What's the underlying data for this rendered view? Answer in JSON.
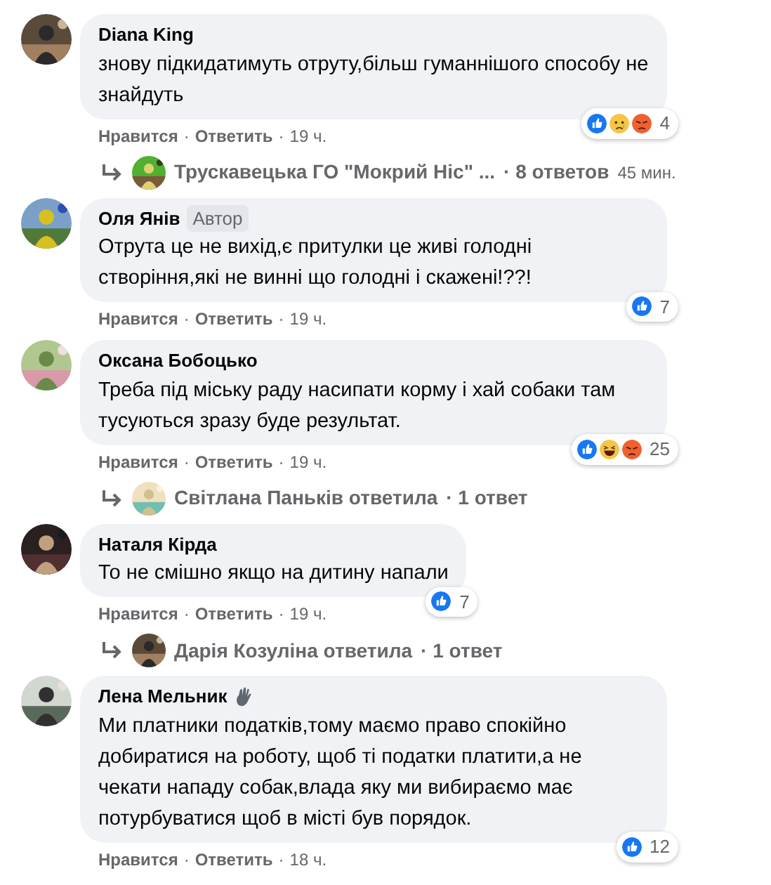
{
  "comments": [
    {
      "author": "Diana King",
      "wave": false,
      "text": "знову підкидатимуть отруту,більш гуманнішого способу не знайдуть",
      "reactions": [
        {
          "kind": "like"
        },
        {
          "kind": "sad"
        },
        {
          "kind": "angry"
        }
      ],
      "reaction_count": "4",
      "actions": {
        "like": "Нравится",
        "reply": "Ответить",
        "time": "19 ч.",
        "sep": "·"
      },
      "replies": {
        "text": "Трускавецька ГО \"Мокрий Ніс\" ...",
        "count": "· 8 ответов",
        "time": "45 мин."
      }
    },
    {
      "author": "Оля Янів",
      "author_badge": "Автор",
      "wave": false,
      "text": "Отрута це не вихід,є притулки це живі голодні створіння,які не винні що голодні і скажені!??!",
      "reactions": [
        {
          "kind": "like"
        }
      ],
      "reaction_count": "7",
      "actions": {
        "like": "Нравится",
        "reply": "Ответить",
        "time": "19 ч.",
        "sep": "·"
      }
    },
    {
      "author": "Оксана Бобоцько",
      "wave": false,
      "text": "Треба під міську раду насипати корму і хай собаки там тусуються зразу буде результат.",
      "reactions": [
        {
          "kind": "like"
        },
        {
          "kind": "haha"
        },
        {
          "kind": "angry"
        }
      ],
      "reaction_count": "25",
      "actions": {
        "like": "Нравится",
        "reply": "Ответить",
        "time": "19 ч.",
        "sep": "·"
      },
      "replies": {
        "text": "Світлана Паньків ответила",
        "count": "· 1 ответ"
      }
    },
    {
      "author": "Наталя Кірда",
      "wave": false,
      "text": "То не смішно якщо на дитину напали",
      "reactions": [
        {
          "kind": "like"
        }
      ],
      "reaction_count": "7",
      "actions": {
        "like": "Нравится",
        "reply": "Ответить",
        "time": "19 ч.",
        "sep": "·"
      },
      "replies": {
        "text": "Дарія Козуліна ответила",
        "count": "· 1 ответ"
      }
    },
    {
      "author": "Лена Мельник",
      "wave": true,
      "text": "Ми платники податків,тому маємо право спокійно добиратися на роботу, щоб ті податки платити,а не чекати нападу собак,влада яку ми вибираємо має потурбуватися щоб в місті був порядок.",
      "reactions": [
        {
          "kind": "like"
        }
      ],
      "reaction_count": "12",
      "actions": {
        "like": "Нравится",
        "reply": "Ответить",
        "time": "18 ч.",
        "sep": "·"
      }
    }
  ]
}
